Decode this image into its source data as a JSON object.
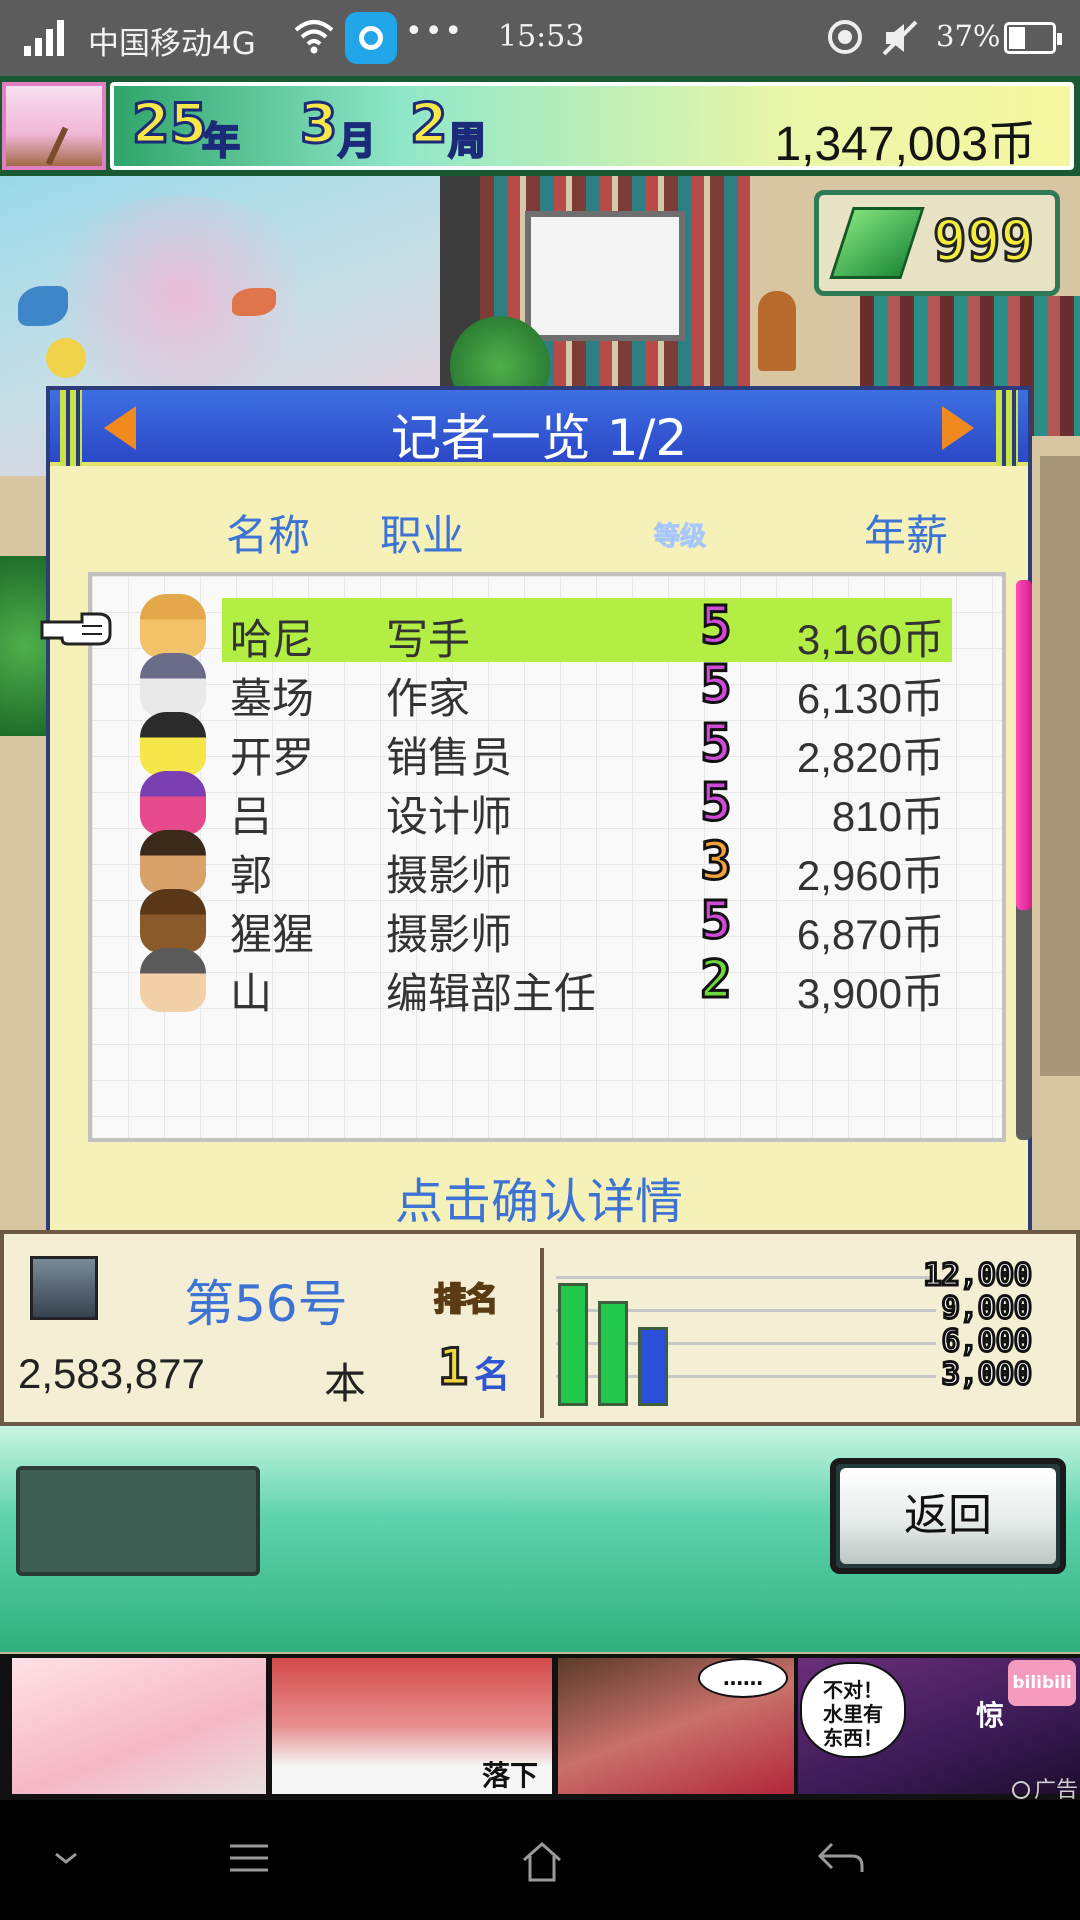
{
  "status_bar": {
    "carrier": "中国移动4G",
    "time": "15:53",
    "battery_percent": "37%",
    "battery_level": 0.37,
    "icons": [
      "signal-icon",
      "wifi-icon",
      "app-notification-icon",
      "more-dots-icon",
      "location-icon",
      "mute-icon",
      "battery-icon"
    ]
  },
  "game": {
    "date": {
      "year": "25",
      "year_unit": "年",
      "month": "3",
      "month_unit": "月",
      "week": "2",
      "week_unit": "周"
    },
    "money": "1,347,003币",
    "gems": "999"
  },
  "dialog": {
    "title": "记者一览 1/2",
    "columns": {
      "name": "名称",
      "job": "职业",
      "rank": "等级",
      "salary": "年薪"
    },
    "rows": [
      {
        "name": "哈尼",
        "job": "写手",
        "rank": "5",
        "salary": "3,160币",
        "selected": true
      },
      {
        "name": "墓场",
        "job": "作家",
        "rank": "5",
        "salary": "6,130币",
        "selected": false
      },
      {
        "name": "开罗",
        "job": "销售员",
        "rank": "5",
        "salary": "2,820币",
        "selected": false
      },
      {
        "name": "吕",
        "job": "设计师",
        "rank": "5",
        "salary": "810币",
        "selected": false
      },
      {
        "name": "郭",
        "job": "摄影师",
        "rank": "3",
        "salary": "2,960币",
        "selected": false
      },
      {
        "name": "猩猩",
        "job": "摄影师",
        "rank": "5",
        "salary": "6,870币",
        "selected": false
      },
      {
        "name": "山",
        "job": "编辑部主任",
        "rank": "2",
        "salary": "3,900币",
        "selected": false
      }
    ],
    "hint": "点击确认详情"
  },
  "stats": {
    "issue": "第56号",
    "rank_label": "排名",
    "copies": "2,583,877",
    "copies_unit": "本",
    "rank_value": "1",
    "rank_suffix": "名"
  },
  "chart_data": {
    "type": "bar",
    "tick_labels": [
      "12,000",
      "9,000",
      "6,000",
      "3,000"
    ],
    "ylim": [
      0,
      12000
    ],
    "values": [
      10500,
      9000,
      6800
    ],
    "colors": [
      "#22c84a",
      "#22c84a",
      "#2b4fd8"
    ]
  },
  "buttons": {
    "back": "返回"
  },
  "ad": {
    "caption_fall": "落下",
    "speech_dots": "……",
    "speech_water": "不对！水里有东西！",
    "caption_shock": "惊",
    "brand": "bilibili",
    "label": "广告"
  },
  "colors": {
    "status_bar_bg": "#5c5c5c",
    "dialog_header": "#2b48c7",
    "selected_row": "#b2ee43",
    "accent_text": "#3c73d4",
    "rank_colors": {
      "5": "#d24bd8",
      "3": "#f2a23a",
      "2": "#6cd83c"
    }
  }
}
